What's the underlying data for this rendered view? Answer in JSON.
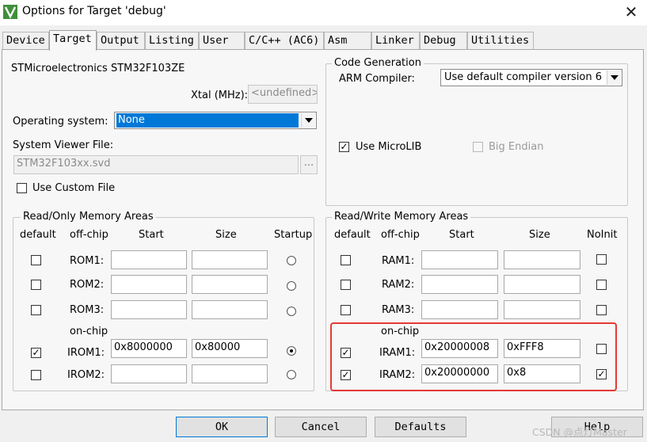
{
  "window": {
    "title": "Options for Target 'debug'",
    "close_glyph": "✕"
  },
  "tabs": [
    "Device",
    "Target",
    "Output",
    "Listing",
    "User",
    "C/C++ (AC6)",
    "Asm",
    "Linker",
    "Debug",
    "Utilities"
  ],
  "active_tab": "Target",
  "device": {
    "name": "STMicroelectronics STM32F103ZE",
    "xtal_label": "Xtal (MHz):",
    "xtal_value": "<undefined>",
    "os_label": "Operating system:",
    "os_value": "None",
    "svf_label": "System Viewer File:",
    "svf_value": "STM32F103xx.svd",
    "svf_browse": "...",
    "custom_file_label": "Use Custom File",
    "custom_file_checked": false
  },
  "code_generation": {
    "title": "Code Generation",
    "compiler_label": "ARM Compiler:",
    "compiler_value": "Use default compiler version 6",
    "microlib_label": "Use MicroLIB",
    "microlib_checked": true,
    "big_endian_label": "Big Endian",
    "big_endian_checked": false
  },
  "ro_memory": {
    "title": "Read/Only Memory Areas",
    "headers": {
      "default": "default",
      "offchip": "off-chip",
      "start": "Start",
      "size": "Size",
      "startup": "Startup"
    },
    "onchip_label": "on-chip",
    "rows": [
      {
        "name": "ROM1:",
        "start": "",
        "size": "",
        "default": false,
        "startup": false
      },
      {
        "name": "ROM2:",
        "start": "",
        "size": "",
        "default": false,
        "startup": false
      },
      {
        "name": "ROM3:",
        "start": "",
        "size": "",
        "default": false,
        "startup": false
      },
      {
        "name": "IROM1:",
        "start": "0x8000000",
        "size": "0x80000",
        "default": true,
        "startup": true
      },
      {
        "name": "IROM2:",
        "start": "",
        "size": "",
        "default": false,
        "startup": false
      }
    ]
  },
  "rw_memory": {
    "title": "Read/Write Memory Areas",
    "headers": {
      "default": "default",
      "offchip": "off-chip",
      "start": "Start",
      "size": "Size",
      "noinit": "NoInit"
    },
    "onchip_label": "on-chip",
    "rows": [
      {
        "name": "RAM1:",
        "start": "",
        "size": "",
        "default": false,
        "noinit": false
      },
      {
        "name": "RAM2:",
        "start": "",
        "size": "",
        "default": false,
        "noinit": false
      },
      {
        "name": "RAM3:",
        "start": "",
        "size": "",
        "default": false,
        "noinit": false
      },
      {
        "name": "IRAM1:",
        "start": "0x20000008",
        "size": "0xFFF8",
        "default": true,
        "noinit": false
      },
      {
        "name": "IRAM2:",
        "start": "0x20000000",
        "size": "0x8",
        "default": true,
        "noinit": true
      }
    ]
  },
  "buttons": {
    "ok": "OK",
    "cancel": "Cancel",
    "defaults": "Defaults",
    "help": "Help"
  },
  "watermark": "CSDN @点灯Master",
  "colors": {
    "highlight": "#e53935",
    "selection": "#0078d7"
  }
}
